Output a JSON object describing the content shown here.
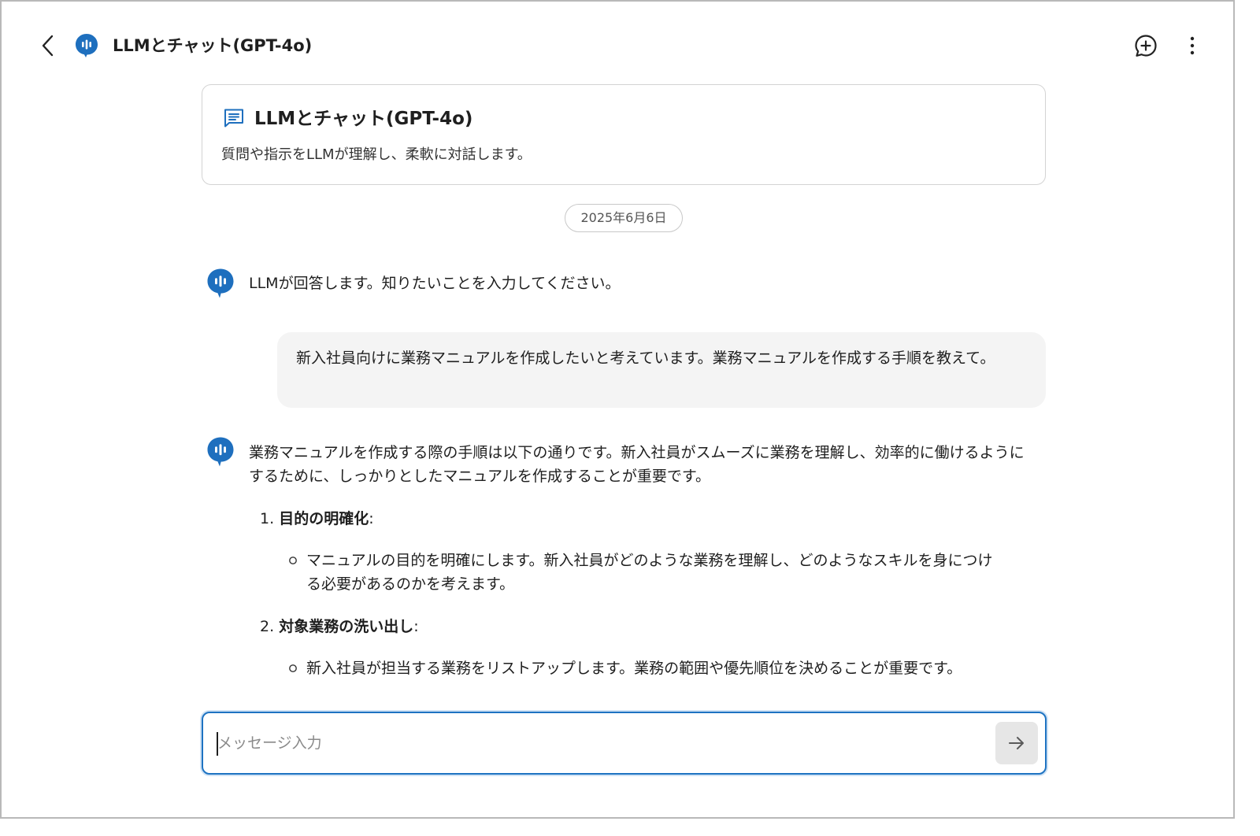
{
  "header": {
    "title": "LLMとチャット(GPT-4o)"
  },
  "info_card": {
    "title": "LLMとチャット(GPT-4o)",
    "description": "質問や指示をLLMが理解し、柔軟に対話します。"
  },
  "date_label": "2025年6月6日",
  "messages": {
    "bot_greeting": "LLMが回答します。知りたいことを入力してください。",
    "user_message": "新入社員向けに業務マニュアルを作成したいと考えています。業務マニュアルを作成する手順を教えて。",
    "bot_reply_intro": "業務マニュアルを作成する際の手順は以下の通りです。新入社員がスムーズに業務を理解し、効率的に働けるようにするために、しっかりとしたマニュアルを作成することが重要です。",
    "steps": [
      {
        "number": "1.",
        "title": "目的の明確化",
        "suffix": ":",
        "detail": "マニュアルの目的を明確にします。新入社員がどのような業務を理解し、どのようなスキルを身につける必要があるのかを考えます。"
      },
      {
        "number": "2.",
        "title": "対象業務の洗い出し",
        "suffix": ":",
        "detail": "新入社員が担当する業務をリストアップします。業務の範囲や優先順位を決めることが重要です。"
      }
    ]
  },
  "input": {
    "placeholder": "メッセージ入力",
    "value": ""
  },
  "icons": {
    "back": "chevron-left-icon",
    "logo": "llm-speech-bubble-icon",
    "new_chat": "new-chat-plus-icon",
    "more": "more-vertical-icon",
    "card": "message-lines-icon",
    "send": "arrow-right-icon"
  },
  "colors": {
    "accent": "#1e73c2",
    "bubble_bg": "#f4f4f4",
    "send_bg": "#e6e6e6"
  }
}
